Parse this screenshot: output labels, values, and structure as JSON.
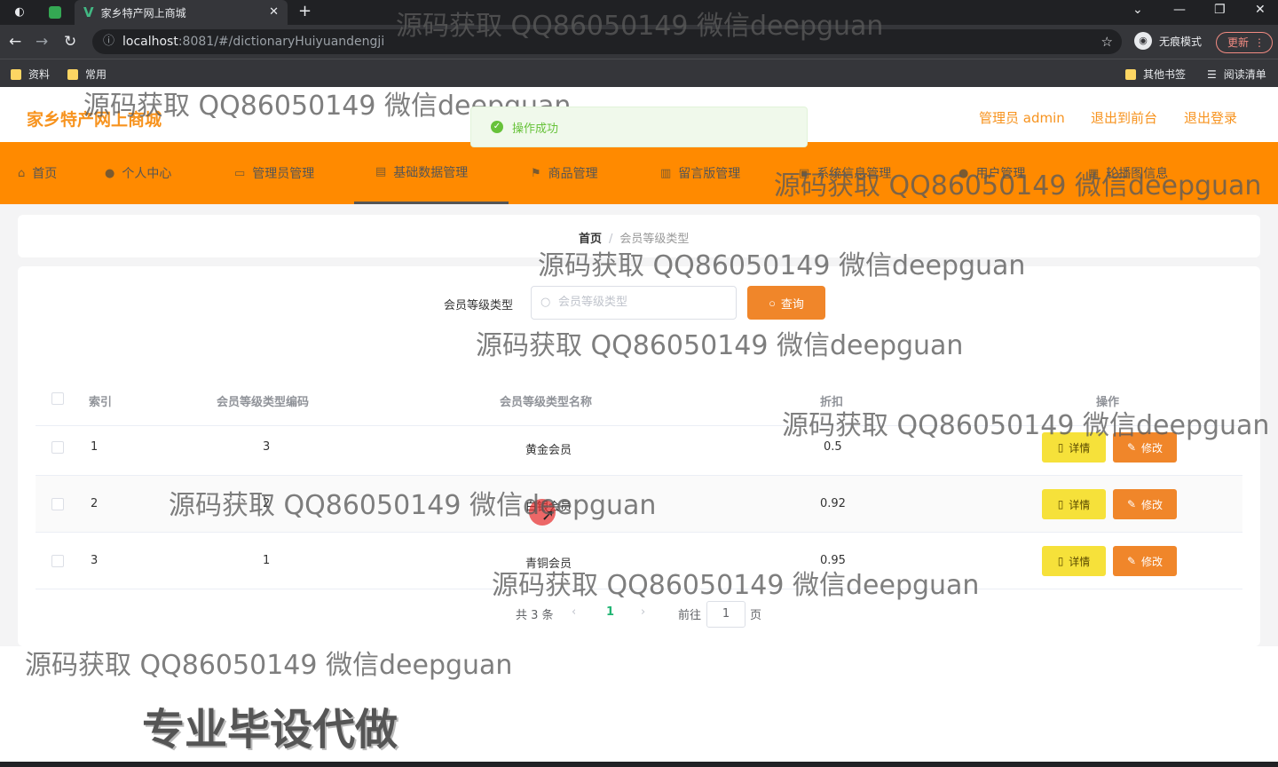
{
  "browser": {
    "tab_title": "家乡特产网上商城",
    "new_tab": "+",
    "url_host": "localhost",
    "url_path": ":8081/#/dictionaryHuiyuandengji",
    "incognito_label": "无痕模式",
    "update_label": "更新",
    "bookmarks": [
      "资料",
      "常用"
    ],
    "bookmarks_right": [
      "其他书签",
      "阅读清单"
    ]
  },
  "header": {
    "site_title": "家乡特产网上商城",
    "links": [
      "管理员 admin",
      "退出到前台",
      "退出登录"
    ]
  },
  "toast": {
    "message": "操作成功"
  },
  "menu": {
    "items": [
      "首页",
      "个人中心",
      "管理员管理",
      "基础数据管理",
      "商品管理",
      "留言版管理",
      "系统信息管理",
      "用户管理",
      "轮播图信息"
    ],
    "active_index": 3
  },
  "breadcrumb": {
    "home": "首页",
    "separator": "/",
    "current": "会员等级类型"
  },
  "search": {
    "label": "会员等级类型",
    "placeholder": "会员等级类型",
    "button": "查询"
  },
  "table": {
    "headers": [
      "索引",
      "会员等级类型编码",
      "会员等级类型名称",
      "折扣",
      "操作"
    ],
    "rows": [
      {
        "index": "1",
        "code": "3",
        "name": "黄金会员",
        "discount": "0.5"
      },
      {
        "index": "2",
        "code": "2",
        "name": "白银会员",
        "discount": "0.92"
      },
      {
        "index": "3",
        "code": "1",
        "name": "青铜会员",
        "discount": "0.95"
      }
    ],
    "detail_label": "详情",
    "edit_label": "修改"
  },
  "pagination": {
    "total": "共 3 条",
    "prev": "‹",
    "current_page": "1",
    "next": "›",
    "goto_label": "前往",
    "goto_value": "1",
    "page_suffix": "页"
  },
  "overlay": {
    "watermark": "源码获取 QQ86050149 微信deepguan",
    "promo": "专业毕设代做"
  },
  "colors": {
    "brand_orange": "#f7931e",
    "menu_bg": "#ff8a00",
    "query_button": "#f0862a",
    "detail_button": "#f6e13a",
    "edit_button": "#f0862a",
    "success": "#67c23a"
  }
}
